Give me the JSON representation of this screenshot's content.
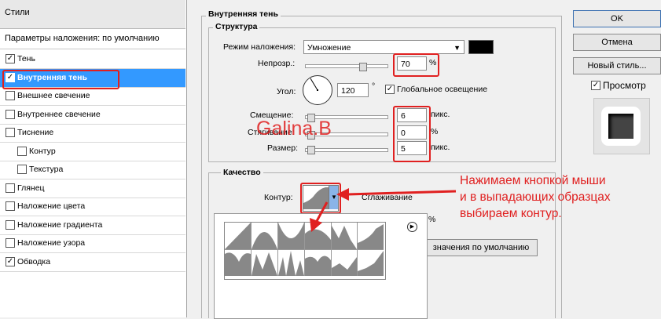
{
  "styles_panel": {
    "header": "Стили",
    "params": "Параметры наложения: по умолчанию",
    "items": [
      {
        "label": "Тень",
        "checked": true,
        "sub": false,
        "selected": false
      },
      {
        "label": "Внутренняя тень",
        "checked": true,
        "sub": false,
        "selected": true
      },
      {
        "label": "Внешнее свечение",
        "checked": false,
        "sub": false,
        "selected": false
      },
      {
        "label": "Внутреннее свечение",
        "checked": false,
        "sub": false,
        "selected": false
      },
      {
        "label": "Тиснение",
        "checked": false,
        "sub": false,
        "selected": false
      },
      {
        "label": "Контур",
        "checked": false,
        "sub": true,
        "selected": false
      },
      {
        "label": "Текстура",
        "checked": false,
        "sub": true,
        "selected": false
      },
      {
        "label": "Глянец",
        "checked": false,
        "sub": false,
        "selected": false
      },
      {
        "label": "Наложение цвета",
        "checked": false,
        "sub": false,
        "selected": false
      },
      {
        "label": "Наложение градиента",
        "checked": false,
        "sub": false,
        "selected": false
      },
      {
        "label": "Наложение узора",
        "checked": false,
        "sub": false,
        "selected": false
      },
      {
        "label": "Обводка",
        "checked": true,
        "sub": false,
        "selected": false
      }
    ]
  },
  "inner_shadow": {
    "title": "Внутренняя тень",
    "structure_title": "Структура",
    "blend_mode_label": "Режим наложения:",
    "blend_mode_value": "Умножение",
    "opacity_label": "Непрозр.:",
    "opacity_value": "70",
    "opacity_unit": "%",
    "opacity_percent": 70,
    "angle_label": "Угол:",
    "angle_value": "120",
    "angle_unit": "°",
    "global_light_label": "Глобальное освещение",
    "global_light_checked": true,
    "distance_label": "Смещение:",
    "distance_value": "6",
    "choke_label": "Стягивание:",
    "choke_value": "0",
    "size_label": "Размер:",
    "size_value": "5",
    "px_unit": "пикс.",
    "quality_title": "Качество",
    "contour_label": "Контур:",
    "antialias_label": "Сглаживание",
    "noise_unit": "%",
    "default_button": "значения по умолчанию",
    "color_swatch": "#000000"
  },
  "buttons": {
    "ok": "OK",
    "cancel": "Отмена",
    "new_style": "Новый стиль...",
    "preview_label": "Просмотр",
    "preview_checked": true
  },
  "annotation": {
    "watermark": "Galina.B",
    "line1": "Нажимаем  кнопкой мыши",
    "line2": "и в выпадающих образцах",
    "line3": "выбираем контур."
  },
  "colors": {
    "selection": "#3399ff",
    "highlight": "#e02020"
  }
}
